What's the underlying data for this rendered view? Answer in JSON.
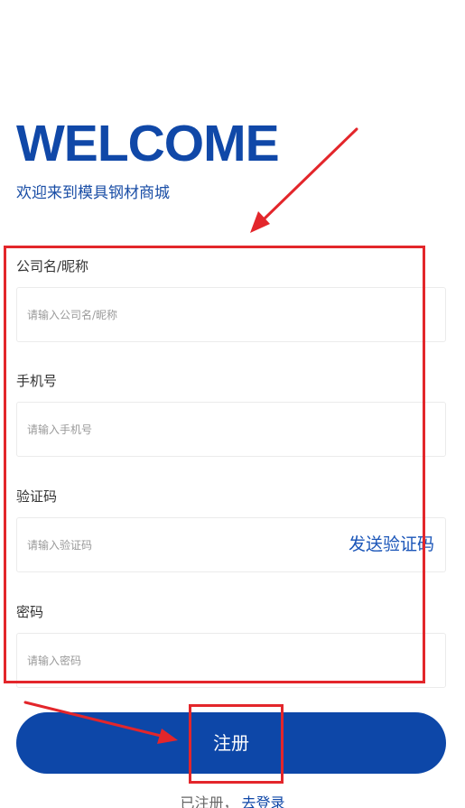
{
  "header": {
    "title": "WELCOME",
    "subtitle": "欢迎来到模具钢材商城"
  },
  "form": {
    "company": {
      "label": "公司名/昵称",
      "placeholder": "请输入公司名/昵称",
      "value": ""
    },
    "phone": {
      "label": "手机号",
      "placeholder": "请输入手机号",
      "value": ""
    },
    "code": {
      "label": "验证码",
      "placeholder": "请输入验证码",
      "value": "",
      "send_label": "发送验证码"
    },
    "password": {
      "label": "密码",
      "placeholder": "请输入密码",
      "value": ""
    }
  },
  "actions": {
    "register_label": "注册",
    "registered_text": "已注册，",
    "login_link": "去登录"
  },
  "colors": {
    "brand": "#0d47a8",
    "annotation": "#e3262b"
  }
}
